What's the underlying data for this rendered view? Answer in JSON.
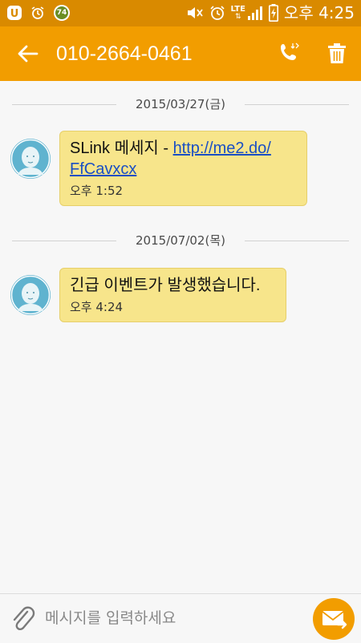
{
  "status_bar": {
    "time": "오후 4:25",
    "network": "LTE",
    "icons": [
      "u-plus-icon",
      "alarm-icon",
      "weather-icon",
      "mute-icon",
      "alarm-icon",
      "lte-signal-icon",
      "battery-charging-icon"
    ],
    "weather_value": "74"
  },
  "header": {
    "contact": "010-2664-0461",
    "icons": [
      "back-arrow-icon",
      "phone-icon",
      "trash-icon"
    ]
  },
  "messages": [
    {
      "date": "2015/03/27(금)",
      "text": "SLink 메세지 - ",
      "link": "http://me2.do/FfCavxcx",
      "link_line1": "http://me2.do/",
      "link_line2": "FfCavxcx",
      "time": "오후 1:52"
    },
    {
      "date": "2015/07/02(목)",
      "text": "긴급 이벤트가 발생했습니다.",
      "time": "오후 4:24"
    }
  ],
  "composer": {
    "placeholder": "메시지를 입력하세요",
    "icons": [
      "paperclip-icon",
      "send-envelope-icon"
    ]
  },
  "colors": {
    "status_bar": "#d98a00",
    "app_bar": "#f29d00",
    "bubble": "#f7e58b",
    "link": "#1a4fc4",
    "send_button": "#f29d00"
  }
}
